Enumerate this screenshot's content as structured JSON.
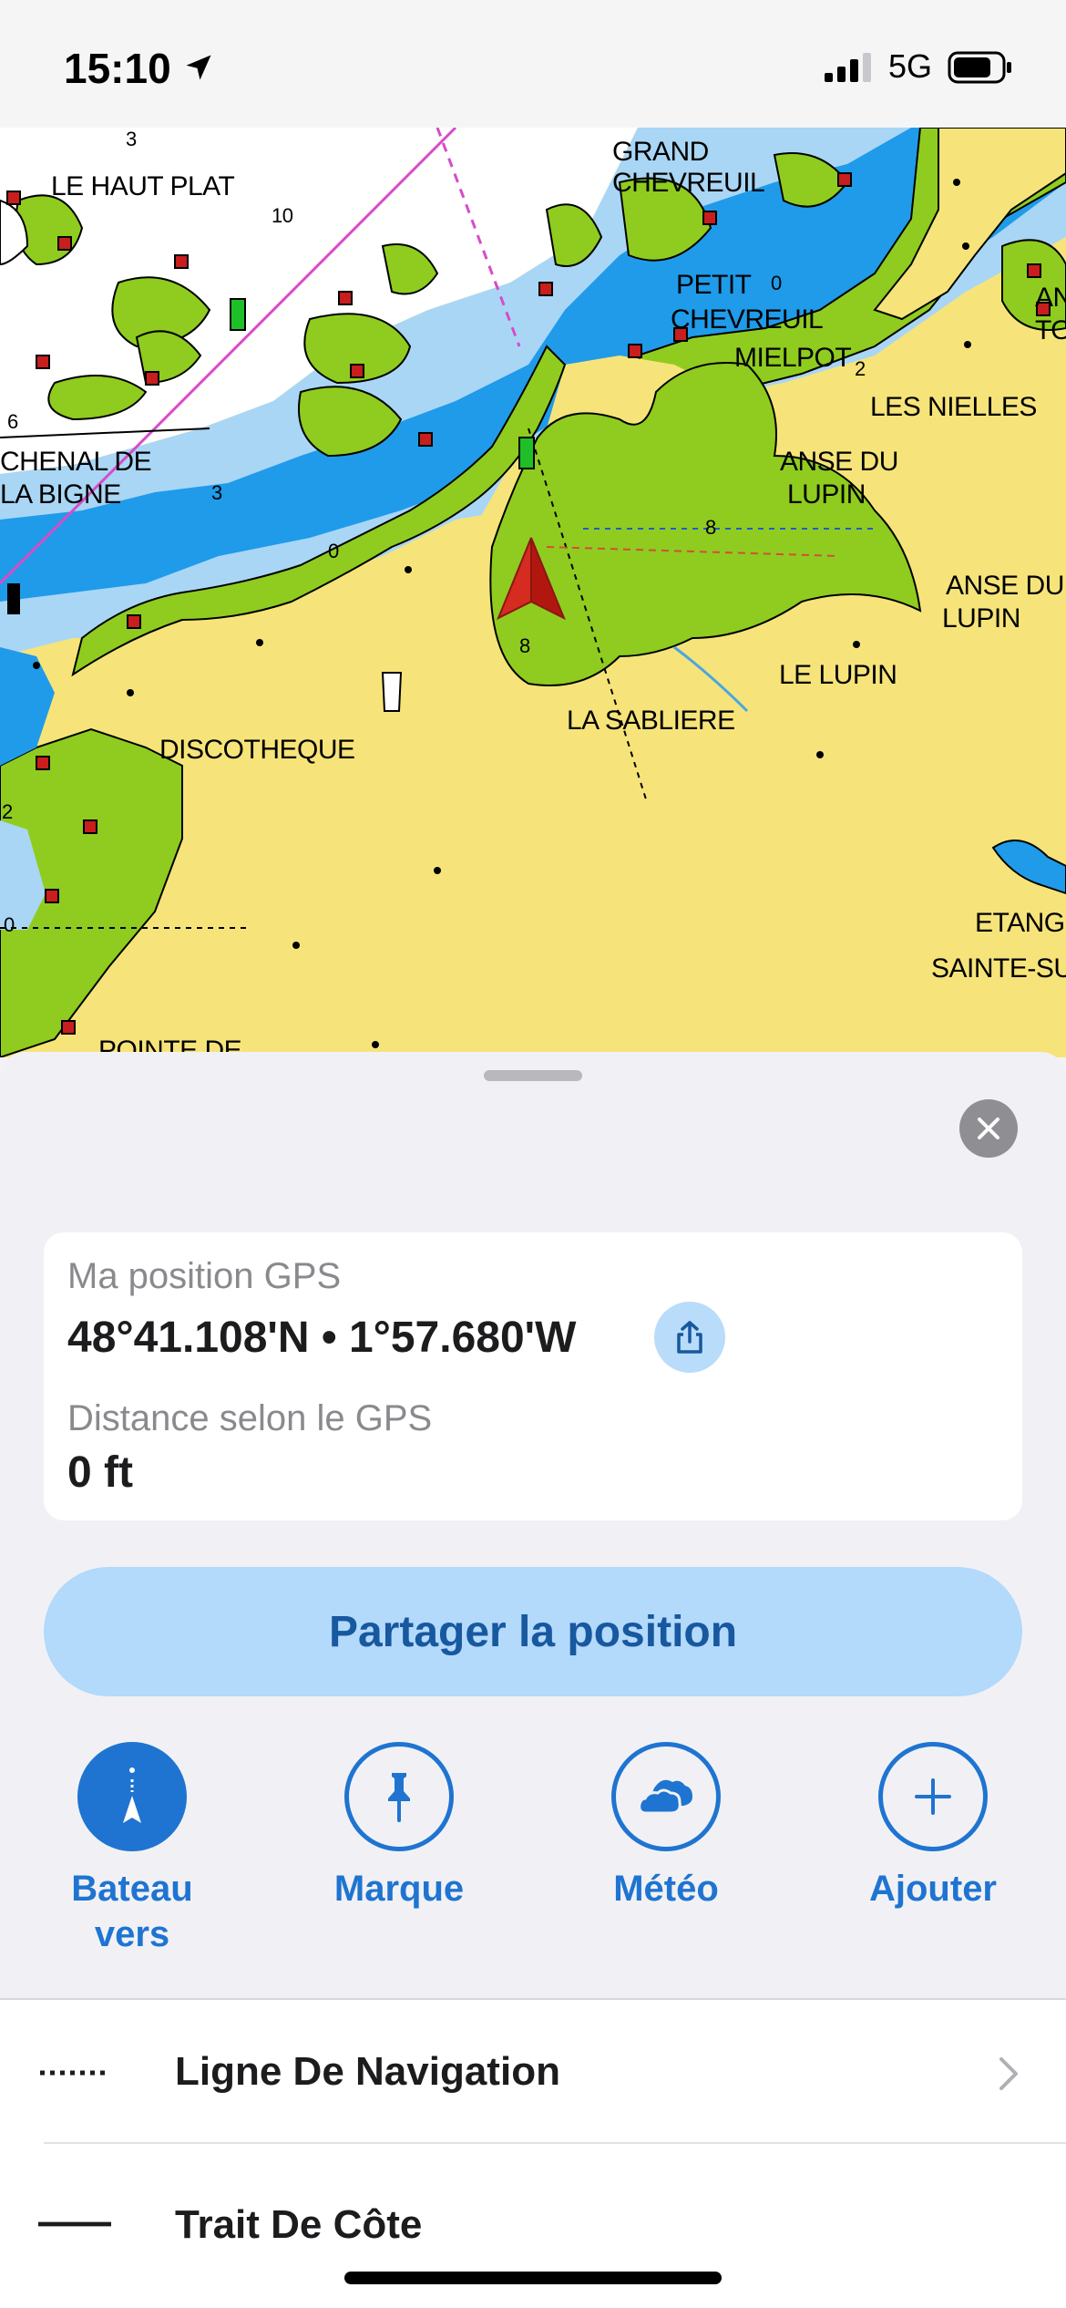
{
  "status_bar": {
    "time": "15:10",
    "network": "5G",
    "icons": [
      "location-arrow-icon",
      "signal-icon",
      "battery-icon"
    ]
  },
  "map": {
    "labels": [
      "LE HAUT PLAT",
      "GRAND",
      "CHEVREUIL",
      "PETIT",
      "CHEVREUIL",
      "MIELPOT",
      "LES NIELLES",
      "CHENAL DE",
      "LA BIGNE",
      "ANSE DU",
      "LUPIN",
      "ANSE DU",
      "LUPIN",
      "LE LUPIN",
      "LA SABLIERE",
      "DISCOTHEQUE",
      "ETANG",
      "SAINTE-SU",
      "POINTE DE",
      "AN",
      "TO"
    ],
    "soundings": [
      "3",
      "10",
      "0",
      "2",
      "6",
      "3",
      "0",
      "8",
      "8",
      "2",
      "0"
    ],
    "colors": {
      "land": "#f6e47a",
      "intertidal": "#8fcc1f",
      "shallow": "#a9d6f5",
      "deep": "#1f9bea",
      "open": "#ffffff",
      "boat": "#d62b1f"
    }
  },
  "sheet": {
    "card": {
      "gps_label": "Ma position GPS",
      "coordinates": "48°41.108'N • 1°57.680'W",
      "distance_label": "Distance selon le GPS",
      "distance_value": "0 ft"
    },
    "share_button": "Partager la position",
    "actions": [
      {
        "line1": "Bateau",
        "line2": "vers",
        "icon": "boat-to-icon"
      },
      {
        "line1": "Marque",
        "line2": "",
        "icon": "pin-icon"
      },
      {
        "line1": "Météo",
        "line2": "",
        "icon": "cloud-icon"
      },
      {
        "line1": "Ajouter",
        "line2": "",
        "icon": "plus-icon"
      }
    ],
    "list": [
      {
        "label": "Ligne De Navigation",
        "style": "dotted"
      },
      {
        "label": "Trait De Côte",
        "style": "solid"
      }
    ],
    "accent": "#1f74d1"
  }
}
